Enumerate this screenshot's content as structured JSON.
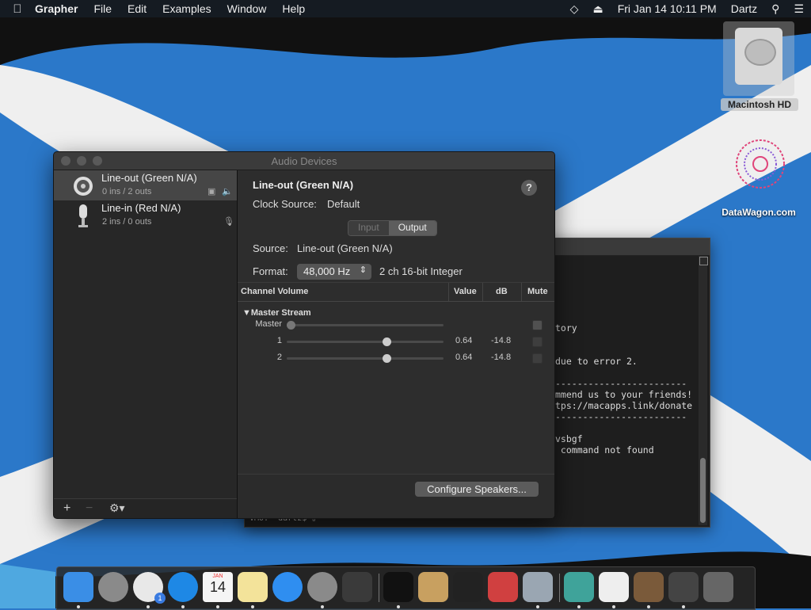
{
  "menubar": {
    "app_name": "Grapher",
    "menus": [
      "File",
      "Edit",
      "Examples",
      "Window",
      "Help"
    ],
    "datetime": "Fri Jan 14  10:11 PM",
    "user": "Dartz"
  },
  "desktop": {
    "icons": [
      {
        "label": "Macintosh HD"
      },
      {
        "label": "DataWagon.com"
      }
    ]
  },
  "terminal": {
    "lines": [
      "",
      "",
      "tory",
      "",
      "",
      "due to error 2.",
      "",
      "------------------------",
      "mmend us to your friends!",
      "tps://macapps.link/donate",
      "------------------------",
      "",
      "vsbgf",
      " command not found"
    ],
    "prompt": "VM0:~ dartz$ ▯"
  },
  "window": {
    "title": "Audio Devices",
    "devices": [
      {
        "name": "Line-out (Green N/A)",
        "io": "0 ins / 2 outs",
        "icon": "speaker-icon",
        "selected": true
      },
      {
        "name": "Line-in (Red N/A)",
        "io": "2 ins / 0 outs",
        "icon": "microphone-icon",
        "selected": false
      }
    ],
    "sidebar_footer": {
      "add": "+",
      "remove": "−",
      "gear": "⚙︎▾"
    },
    "detail": {
      "device_title": "Line-out (Green N/A)",
      "help": "?",
      "clock_label": "Clock Source:",
      "clock_value": "Default",
      "tabs": [
        {
          "label": "Input",
          "active": false
        },
        {
          "label": "Output",
          "active": true
        }
      ],
      "source_label": "Source:",
      "source_value": "Line-out (Green N/A)",
      "format_label": "Format:",
      "format_value": "48,000 Hz",
      "format_extra": "2 ch 16-bit Integer",
      "volume_table": {
        "headers": {
          "channel": "Channel Volume",
          "value": "Value",
          "db": "dB",
          "mute": "Mute"
        },
        "stream_name": "Master Stream",
        "rows": [
          {
            "label": "Master",
            "level": 0.0,
            "value": "",
            "db": "",
            "enabled": false
          },
          {
            "label": "1",
            "level": 0.64,
            "value": "0.64",
            "db": "-14.8",
            "enabled": true
          },
          {
            "label": "2",
            "level": 0.64,
            "value": "0.64",
            "db": "-14.8",
            "enabled": true
          }
        ]
      },
      "configure_button": "Configure Speakers..."
    }
  },
  "colors": {
    "window_bg": "#2a2a2a",
    "flag_blue": "#2b78c9",
    "flag_white": "#f2f2f2"
  },
  "dock": {
    "apps": [
      "finder-icon",
      "launchpad-icon",
      "chrome-icon",
      "safari-icon",
      "calendar-icon",
      "notes-icon",
      "app-store-icon",
      "system-preferences-icon",
      "photo-app-icon",
      "terminal-icon",
      "chess-icon",
      "piano-icon",
      "colorsync-icon",
      "utilities-icon",
      "app-icon",
      "document-icon",
      "chess-board-icon",
      "stack-icon",
      "trash-icon"
    ],
    "calendar_month": "JAN",
    "calendar_day": "14",
    "chrome_badge": "1"
  }
}
